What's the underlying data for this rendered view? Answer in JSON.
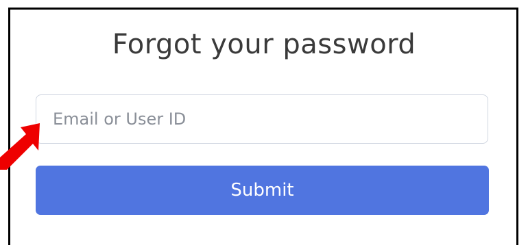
{
  "form": {
    "title": "Forgot your password",
    "identifier_placeholder": "Email or User ID",
    "identifier_value": "",
    "submit_label": "Submit"
  },
  "annotation": {
    "arrow_color": "#ee0000",
    "icon": "red-pointer-arrow-icon"
  },
  "colors": {
    "primary_button": "#5075e0",
    "title_text": "#3a3a3a"
  }
}
